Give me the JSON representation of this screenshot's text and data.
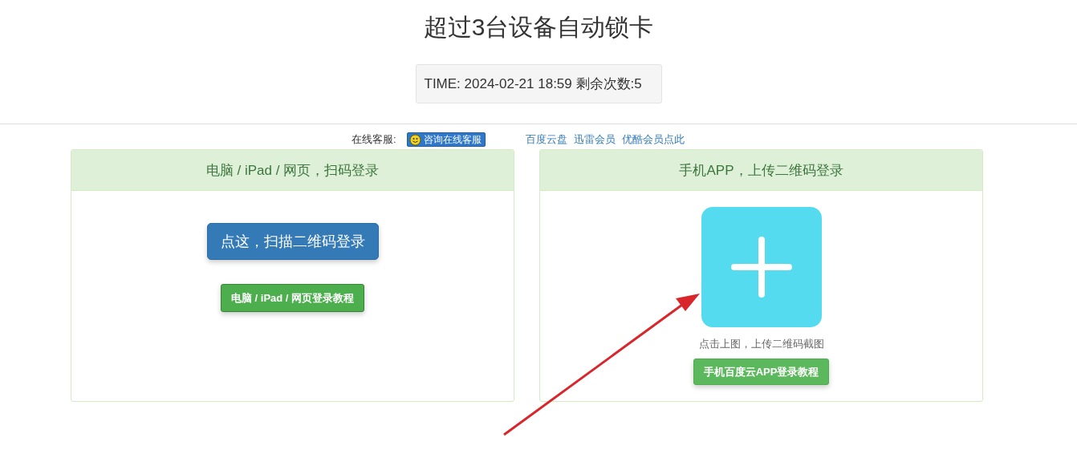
{
  "title": "超过3台设备自动锁卡",
  "time_box": "TIME: 2024-02-21 18:59 剩余次数:5",
  "support": {
    "label": "在线客服:",
    "button": "咨询在线客服"
  },
  "links": [
    "百度云盘",
    "迅雷会员",
    "优酷会员点此"
  ],
  "panels": [
    {
      "kind": "scan",
      "heading": "电脑 / iPad / 网页，扫码登录",
      "primary_button": "点这，扫描二维码登录",
      "tutorial_button": "电脑 / iPad / 网页登录教程"
    },
    {
      "kind": "upload",
      "heading": "手机APP，上传二维码登录",
      "hint": "点击上图，上传二维码截图",
      "tutorial_button": "手机百度云APP登录教程"
    }
  ],
  "annotation": {
    "kind": "arrow"
  }
}
